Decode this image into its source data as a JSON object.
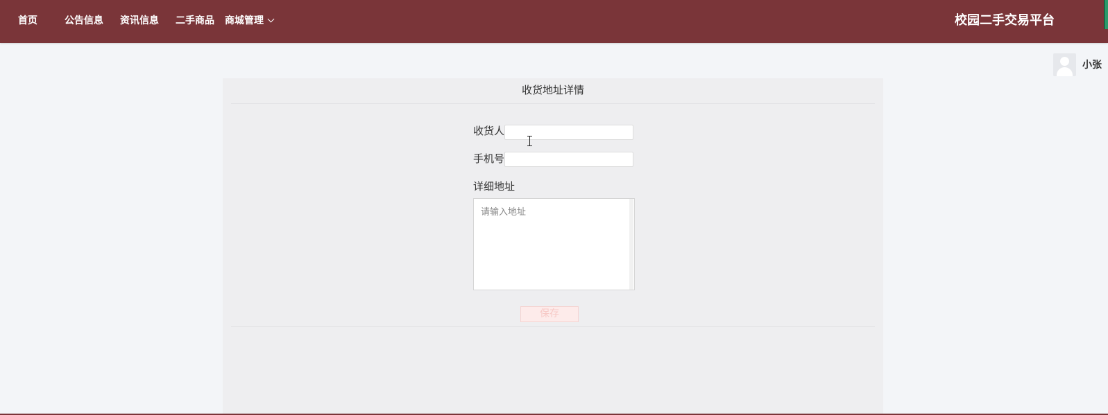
{
  "nav": {
    "items": [
      {
        "label": "首页"
      },
      {
        "label": "公告信息"
      },
      {
        "label": "资讯信息"
      },
      {
        "label": "二手商品"
      },
      {
        "label": "商城管理"
      }
    ]
  },
  "header": {
    "site_title": "校园二手交易平台"
  },
  "user": {
    "name": "小张",
    "avatar_icon": "user-avatar-icon"
  },
  "form": {
    "title": "收货地址详情",
    "recipient": {
      "label": "收货人",
      "value": ""
    },
    "phone": {
      "label": "手机号",
      "value": ""
    },
    "address": {
      "label": "详细地址",
      "placeholder": "请输入地址",
      "value": ""
    },
    "save_label": "保存"
  },
  "colors": {
    "header_bg": "#7a3539",
    "page_bg": "#f3f5f8",
    "panel_bg": "#eeeef0",
    "save_button_bg": "#fdebea"
  }
}
